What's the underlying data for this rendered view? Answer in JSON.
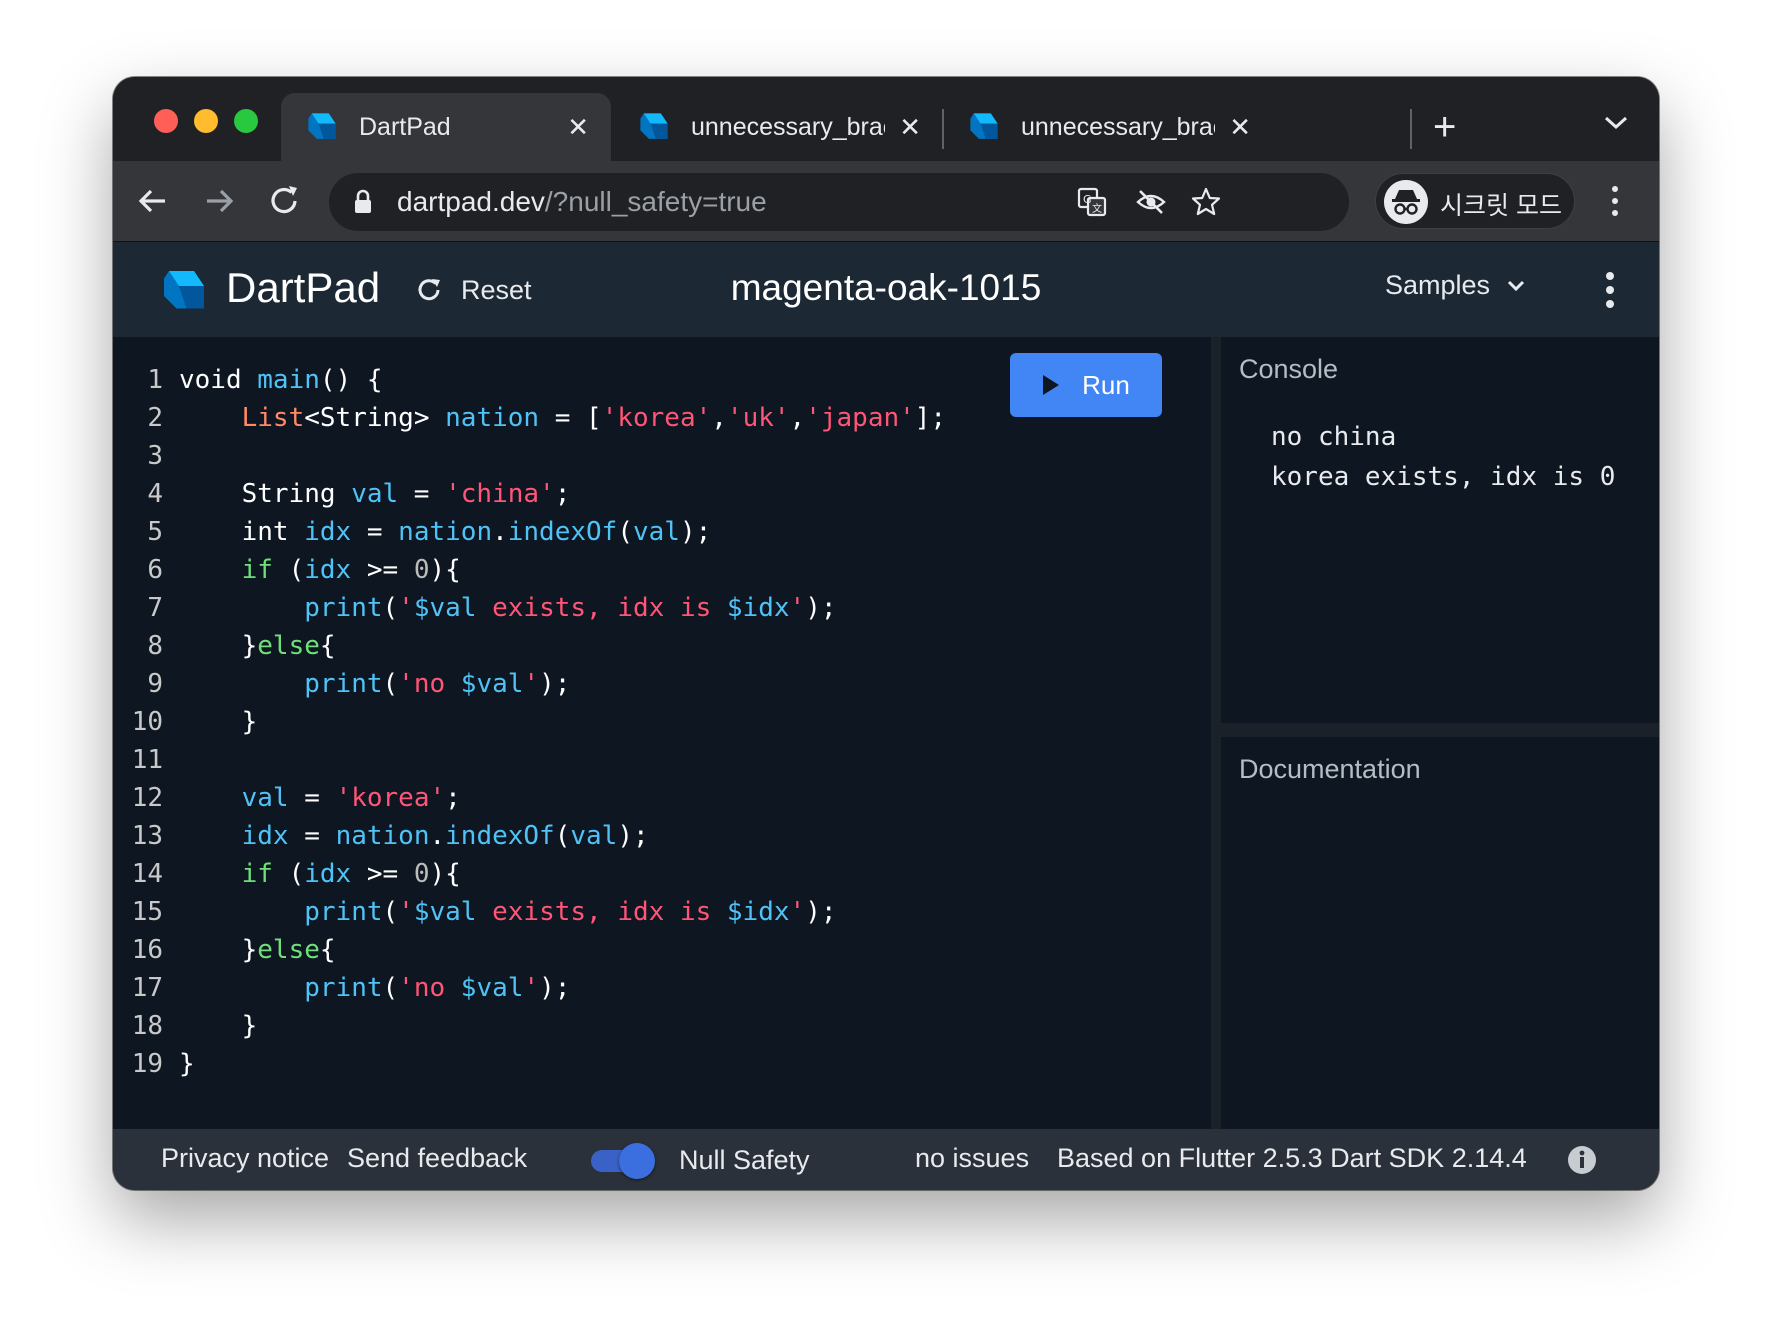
{
  "browser": {
    "tabs": [
      {
        "title": "DartPad",
        "active": true
      },
      {
        "title": "unnecessary_brace_i",
        "active": false
      },
      {
        "title": "unnecessary_brace_i",
        "active": false
      }
    ],
    "close_glyph": "✕",
    "new_tab_glyph": "+",
    "url_host": "dartpad.dev",
    "url_path": "/?null_safety=true",
    "profile_name": "시크릿 모드",
    "icons": [
      "back-icon",
      "forward-icon",
      "reload-icon",
      "lock-icon",
      "translate-icon",
      "eye-off-icon",
      "star-icon",
      "incognito-icon",
      "kebab-icon",
      "tab-search-icon"
    ]
  },
  "header": {
    "app_title": "DartPad",
    "reset_label": "Reset",
    "pad_name": "magenta-oak-1015",
    "samples_label": "Samples"
  },
  "editor": {
    "run_label": "Run",
    "lines": [
      {
        "n": "1",
        "tokens": [
          {
            "t": "void ",
            "c": "kw"
          },
          {
            "t": "main",
            "c": "fn"
          },
          {
            "t": "() {",
            "c": "kw"
          }
        ]
      },
      {
        "n": "2",
        "tokens": [
          {
            "t": "    "
          },
          {
            "t": "List",
            "c": "ty"
          },
          {
            "t": "<String> ",
            "c": "kw"
          },
          {
            "t": "nation",
            "c": "va"
          },
          {
            "t": " = [",
            "c": "kw"
          },
          {
            "t": "'korea'",
            "c": "st"
          },
          {
            "t": ",",
            "c": "kw"
          },
          {
            "t": "'uk'",
            "c": "st"
          },
          {
            "t": ",",
            "c": "kw"
          },
          {
            "t": "'japan'",
            "c": "st"
          },
          {
            "t": "];",
            "c": "kw"
          }
        ]
      },
      {
        "n": "3",
        "tokens": []
      },
      {
        "n": "4",
        "tokens": [
          {
            "t": "    String ",
            "c": "kw"
          },
          {
            "t": "val",
            "c": "va"
          },
          {
            "t": " = ",
            "c": "kw"
          },
          {
            "t": "'china'",
            "c": "st"
          },
          {
            "t": ";",
            "c": "kw"
          }
        ]
      },
      {
        "n": "5",
        "tokens": [
          {
            "t": "    int ",
            "c": "kw"
          },
          {
            "t": "idx",
            "c": "va"
          },
          {
            "t": " = ",
            "c": "kw"
          },
          {
            "t": "nation",
            "c": "va"
          },
          {
            "t": ".",
            "c": "kw"
          },
          {
            "t": "indexOf",
            "c": "fn"
          },
          {
            "t": "(",
            "c": "kw"
          },
          {
            "t": "val",
            "c": "va"
          },
          {
            "t": ");",
            "c": "kw"
          }
        ]
      },
      {
        "n": "6",
        "tokens": [
          {
            "t": "    "
          },
          {
            "t": "if",
            "c": "ctl"
          },
          {
            "t": " (",
            "c": "kw"
          },
          {
            "t": "idx",
            "c": "va"
          },
          {
            "t": " >= ",
            "c": "kw"
          },
          {
            "t": "0",
            "c": "num"
          },
          {
            "t": "){",
            "c": "kw"
          }
        ]
      },
      {
        "n": "7",
        "tokens": [
          {
            "t": "        "
          },
          {
            "t": "print",
            "c": "fn"
          },
          {
            "t": "(",
            "c": "kw"
          },
          {
            "t": "'",
            "c": "st"
          },
          {
            "t": "$val",
            "c": "va"
          },
          {
            "t": " exists, idx is ",
            "c": "st"
          },
          {
            "t": "$idx",
            "c": "va"
          },
          {
            "t": "'",
            "c": "st"
          },
          {
            "t": ");",
            "c": "kw"
          }
        ]
      },
      {
        "n": "8",
        "tokens": [
          {
            "t": "    }",
            "c": "kw"
          },
          {
            "t": "else",
            "c": "ctl"
          },
          {
            "t": "{",
            "c": "kw"
          }
        ]
      },
      {
        "n": "9",
        "tokens": [
          {
            "t": "        "
          },
          {
            "t": "print",
            "c": "fn"
          },
          {
            "t": "(",
            "c": "kw"
          },
          {
            "t": "'no ",
            "c": "st"
          },
          {
            "t": "$val",
            "c": "va"
          },
          {
            "t": "'",
            "c": "st"
          },
          {
            "t": ");",
            "c": "kw"
          }
        ]
      },
      {
        "n": "10",
        "tokens": [
          {
            "t": "    }",
            "c": "kw"
          }
        ]
      },
      {
        "n": "11",
        "tokens": []
      },
      {
        "n": "12",
        "tokens": [
          {
            "t": "    "
          },
          {
            "t": "val",
            "c": "va"
          },
          {
            "t": " = ",
            "c": "kw"
          },
          {
            "t": "'korea'",
            "c": "st"
          },
          {
            "t": ";",
            "c": "kw"
          }
        ]
      },
      {
        "n": "13",
        "tokens": [
          {
            "t": "    "
          },
          {
            "t": "idx",
            "c": "va"
          },
          {
            "t": " = ",
            "c": "kw"
          },
          {
            "t": "nation",
            "c": "va"
          },
          {
            "t": ".",
            "c": "kw"
          },
          {
            "t": "indexOf",
            "c": "fn"
          },
          {
            "t": "(",
            "c": "kw"
          },
          {
            "t": "val",
            "c": "va"
          },
          {
            "t": ");",
            "c": "kw"
          }
        ]
      },
      {
        "n": "14",
        "tokens": [
          {
            "t": "    "
          },
          {
            "t": "if",
            "c": "ctl"
          },
          {
            "t": " (",
            "c": "kw"
          },
          {
            "t": "idx",
            "c": "va"
          },
          {
            "t": " >= ",
            "c": "kw"
          },
          {
            "t": "0",
            "c": "num"
          },
          {
            "t": "){",
            "c": "kw"
          }
        ]
      },
      {
        "n": "15",
        "tokens": [
          {
            "t": "        "
          },
          {
            "t": "print",
            "c": "fn"
          },
          {
            "t": "(",
            "c": "kw"
          },
          {
            "t": "'",
            "c": "st"
          },
          {
            "t": "$val",
            "c": "va"
          },
          {
            "t": " exists, idx is ",
            "c": "st"
          },
          {
            "t": "$idx",
            "c": "va"
          },
          {
            "t": "'",
            "c": "st"
          },
          {
            "t": ");",
            "c": "kw"
          }
        ]
      },
      {
        "n": "16",
        "tokens": [
          {
            "t": "    }",
            "c": "kw"
          },
          {
            "t": "else",
            "c": "ctl"
          },
          {
            "t": "{",
            "c": "kw"
          }
        ]
      },
      {
        "n": "17",
        "tokens": [
          {
            "t": "        "
          },
          {
            "t": "print",
            "c": "fn"
          },
          {
            "t": "(",
            "c": "kw"
          },
          {
            "t": "'no ",
            "c": "st"
          },
          {
            "t": "$val",
            "c": "va"
          },
          {
            "t": "'",
            "c": "st"
          },
          {
            "t": ");",
            "c": "kw"
          }
        ]
      },
      {
        "n": "18",
        "tokens": [
          {
            "t": "    }",
            "c": "kw"
          }
        ]
      },
      {
        "n": "19",
        "tokens": [
          {
            "t": "}",
            "c": "kw"
          }
        ]
      }
    ]
  },
  "console": {
    "title": "Console",
    "output": "no china\nkorea exists, idx is 0"
  },
  "docs": {
    "title": "Documentation"
  },
  "footer": {
    "privacy": "Privacy notice",
    "feedback": "Send feedback",
    "null_safety_label": "Null Safety",
    "null_safety_enabled": true,
    "issues": "no issues",
    "version": "Based on Flutter 2.5.3 Dart SDK 2.14.4"
  },
  "colors": {
    "run_button": "#4285f4",
    "editor_bg": "#0e1621",
    "header_bg": "#1c2834",
    "footer_bg": "#2a313a"
  }
}
